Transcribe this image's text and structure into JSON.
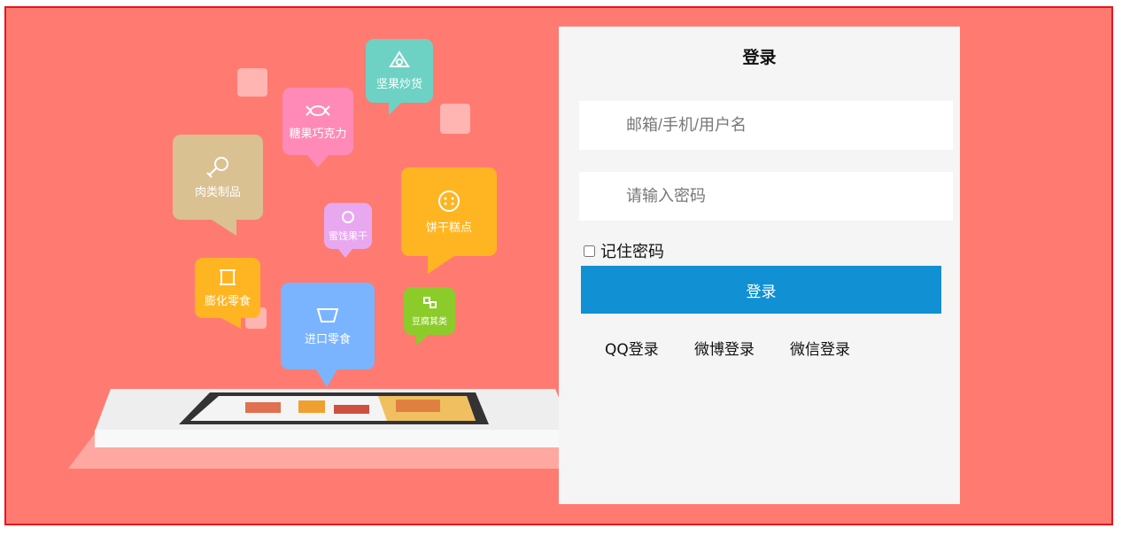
{
  "login": {
    "title": "登录",
    "username_placeholder": "邮箱/手机/用户名",
    "password_placeholder": "请输入密码",
    "remember_label": "记住密码",
    "submit_label": "登录",
    "social": [
      "QQ登录",
      "微博登录",
      "微信登录"
    ]
  },
  "categories": [
    "坚果炒货",
    "糖果巧克力",
    "肉类制品",
    "蜜饯果干",
    "饼干糕点",
    "膨化零食",
    "进口零食",
    "豆腐其类"
  ],
  "colors": {
    "background": "#ff7b72",
    "border": "#e8151c",
    "panel": "#f5f5f5",
    "button": "#1190d3"
  }
}
